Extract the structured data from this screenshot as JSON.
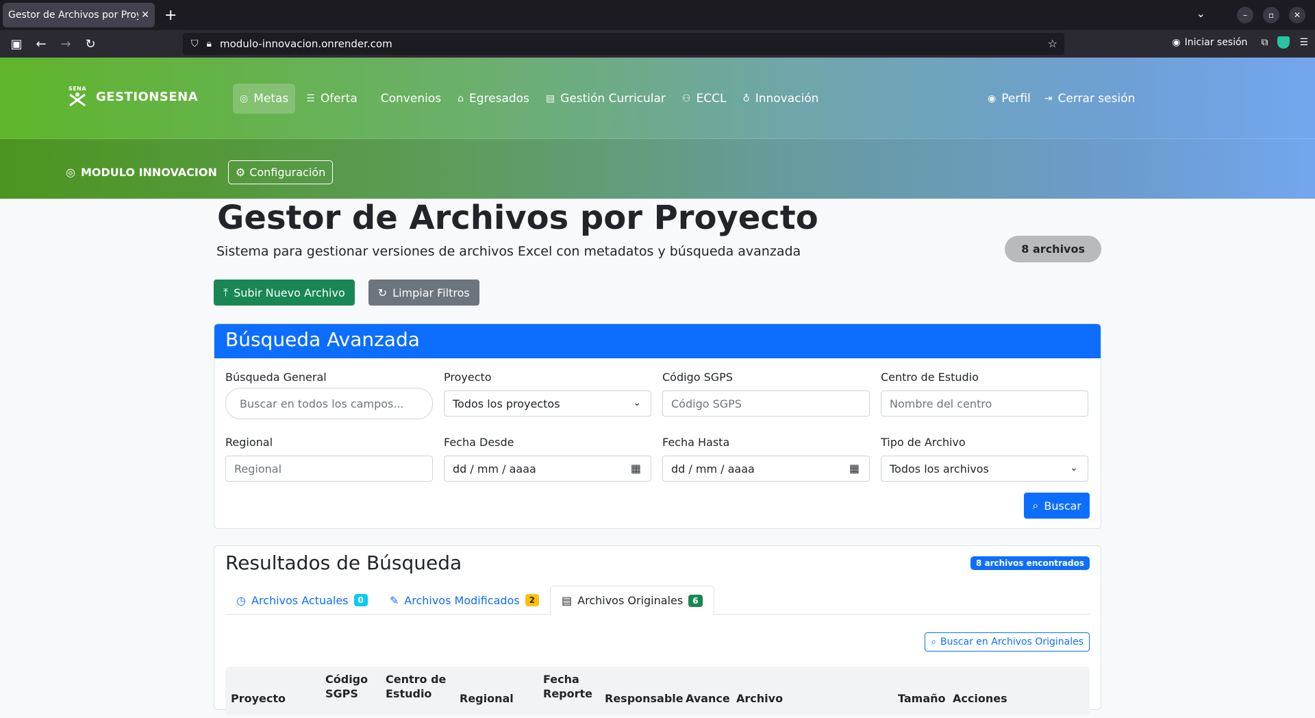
{
  "browser": {
    "tab_title": "Gestor de Archivos por Proyecto",
    "tab_close": "✕",
    "new_tab": "+",
    "url": "modulo-innovacion.onrender.com",
    "signin_label": "Iniciar sesión"
  },
  "header": {
    "brand": "GESTIONSENA",
    "logo_text": "SENA",
    "menu": [
      {
        "label": "Metas",
        "icon": "target-icon"
      },
      {
        "label": "Oferta",
        "icon": "list-icon"
      },
      {
        "label": "Convenios",
        "icon": "handshake-icon"
      },
      {
        "label": "Egresados",
        "icon": "graduation-cap-icon"
      },
      {
        "label": "Gestión Curricular",
        "icon": "document-icon"
      },
      {
        "label": "ECCL",
        "icon": "people-icon"
      },
      {
        "label": "Innovación",
        "icon": "lightbulb-icon"
      }
    ],
    "user_menu": {
      "profile": "Perfil",
      "logout": "Cerrar sesión"
    },
    "module_name": "MODULO INNOVACION",
    "config_label": "Configuración"
  },
  "main": {
    "title": "Gestor de Archivos por Proyecto",
    "subtitle": "Sistema para gestionar versiones de archivos Excel con metadatos y búsqueda avanzada",
    "file_count": "8 archivos",
    "upload_label": "Subir Nuevo Archivo",
    "clear_label": "Limpiar Filtros"
  },
  "search": {
    "title": "Búsqueda Avanzada",
    "general": {
      "label": "Búsqueda General",
      "placeholder": "Buscar en todos los campos..."
    },
    "project": {
      "label": "Proyecto",
      "value": "Todos los proyectos"
    },
    "sgps": {
      "label": "Código SGPS",
      "placeholder": "Código SGPS"
    },
    "center": {
      "label": "Centro de Estudio",
      "placeholder": "Nombre del centro"
    },
    "regional": {
      "label": "Regional",
      "placeholder": "Regional"
    },
    "date_from": {
      "label": "Fecha Desde",
      "placeholder": "dd / mm / aaaa"
    },
    "date_to": {
      "label": "Fecha Hasta",
      "placeholder": "dd / mm / aaaa"
    },
    "file_type": {
      "label": "Tipo de Archivo",
      "value": "Todos los archivos"
    },
    "search_button": "Buscar"
  },
  "results": {
    "title": "Resultados de Búsqueda",
    "found": "8 archivos encontrados",
    "tabs": [
      {
        "label": "Archivos Actuales",
        "count": "0"
      },
      {
        "label": "Archivos Modificados",
        "count": "2"
      },
      {
        "label": "Archivos Originales",
        "count": "6"
      }
    ],
    "search_originals": "Buscar en Archivos Originales",
    "columns": {
      "project": "Proyecto",
      "sgps": "Código SGPS",
      "center": "Centro de Estudio",
      "regional": "Regional",
      "report_date": "Fecha Reporte",
      "responsible": "Responsable",
      "progress": "Avance",
      "file": "Archivo",
      "size": "Tamaño",
      "actions": "Acciones"
    }
  },
  "colors": {
    "primary": "#0d6efd",
    "success": "#198754",
    "secondary": "#6c757d",
    "header_green": "#5fb52b",
    "header_blue": "#74a6ef"
  }
}
